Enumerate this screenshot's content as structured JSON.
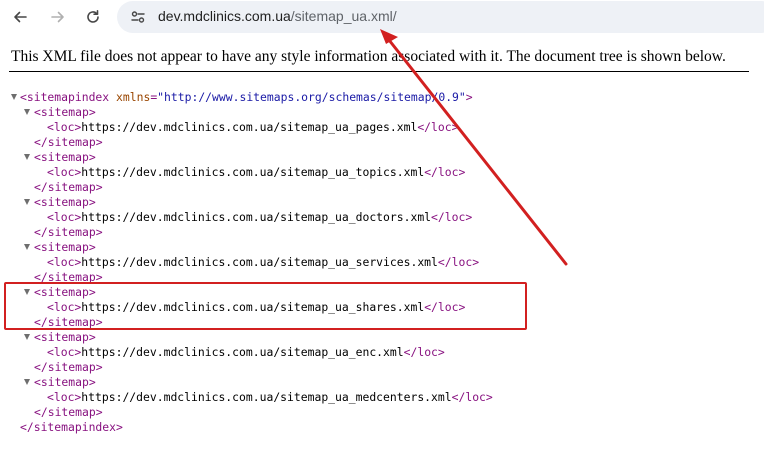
{
  "browser": {
    "url_host": "dev.mdclinics.com.ua",
    "url_path": "/sitemap_ua.xml/"
  },
  "page": {
    "info_message": "This XML file does not appear to have any style information associated with it. The document tree is shown below."
  },
  "xml": {
    "root_open": "<sitemapindex",
    "attr_name": "xmlns",
    "attr_value": "\"http://www.sitemaps.org/schemas/sitemap/0.9\"",
    "root_open_end": ">",
    "root_close": "</sitemapindex>",
    "sitemap_open": "<sitemap>",
    "sitemap_close": "</sitemap>",
    "loc_open": "<loc>",
    "loc_close": "</loc>",
    "entries": [
      "https://dev.mdclinics.com.ua/sitemap_ua_pages.xml",
      "https://dev.mdclinics.com.ua/sitemap_ua_topics.xml",
      "https://dev.mdclinics.com.ua/sitemap_ua_doctors.xml",
      "https://dev.mdclinics.com.ua/sitemap_ua_services.xml",
      "https://dev.mdclinics.com.ua/sitemap_ua_shares.xml",
      "https://dev.mdclinics.com.ua/sitemap_ua_enc.xml",
      "https://dev.mdclinics.com.ua/sitemap_ua_medcenters.xml"
    ]
  },
  "annotation": {
    "color": "#d22020",
    "highlighted_entry": "https://dev.mdclinics.com.ua/sitemap_ua_shares.xml"
  }
}
